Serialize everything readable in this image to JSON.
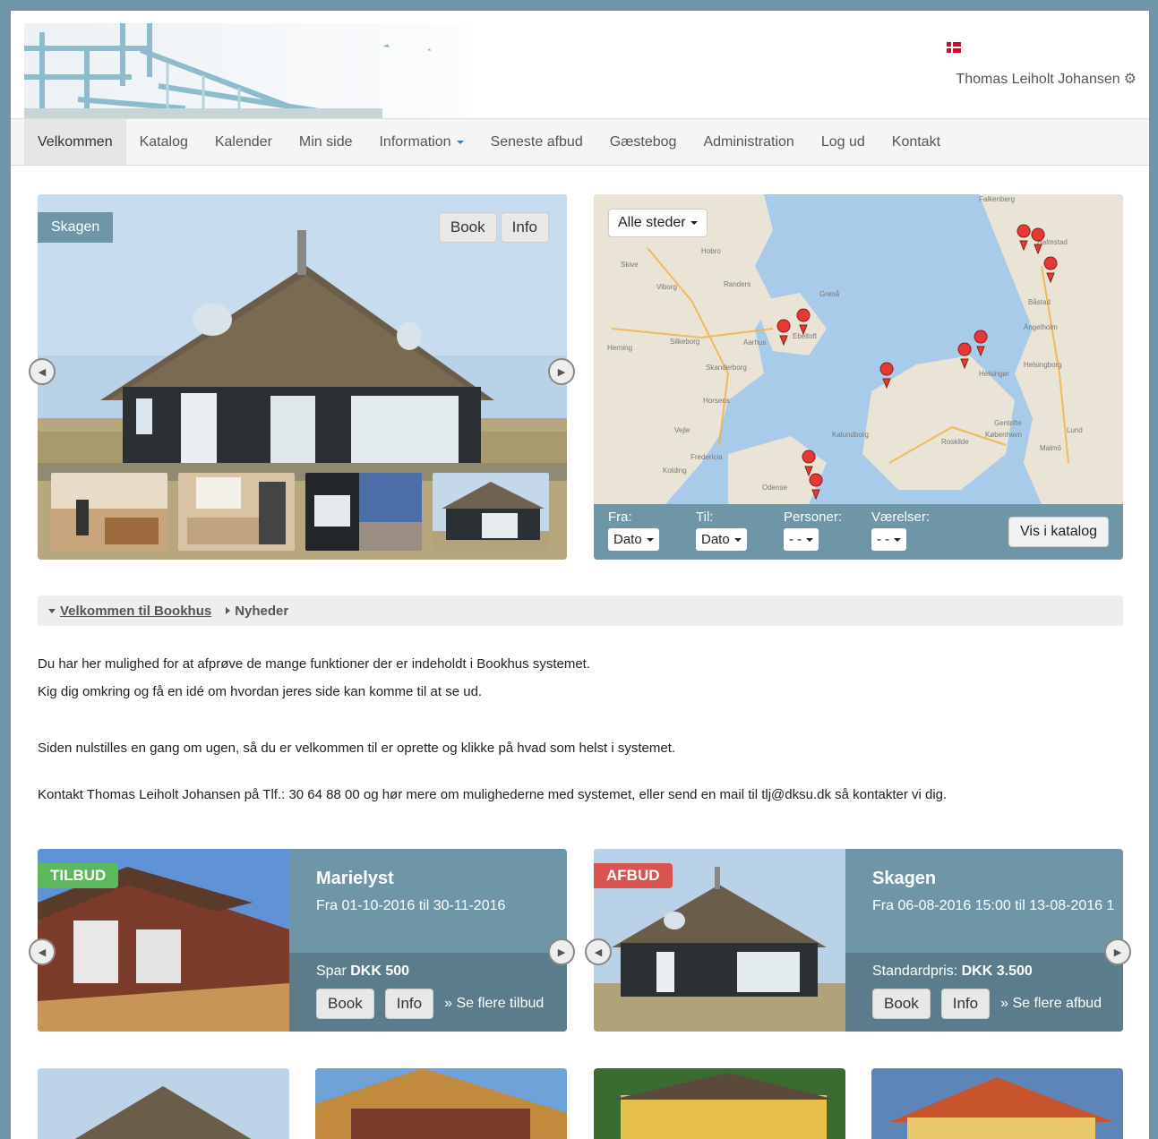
{
  "header": {
    "user_name": "Thomas Leiholt Johansen",
    "flag_icon": "danish-flag-icon",
    "settings_icon": "gear-icon"
  },
  "nav": {
    "items": [
      "Velkommen",
      "Katalog",
      "Kalender",
      "Min side",
      "Information",
      "Seneste afbud",
      "Gæstebog",
      "Administration",
      "Log ud",
      "Kontakt"
    ],
    "active": "Velkommen"
  },
  "hero": {
    "place": "Skagen",
    "book_label": "Book",
    "info_label": "Info"
  },
  "map": {
    "locations_dropdown": "Alle steder",
    "filters": {
      "from_label": "Fra:",
      "from_value": "Dato",
      "to_label": "Til:",
      "to_value": "Dato",
      "persons_label": "Personer:",
      "persons_value": "- -",
      "rooms_label": "Værelser:",
      "rooms_value": "- -"
    },
    "show_button": "Vis i katalog",
    "city_labels": [
      "Hobro",
      "Viborg",
      "Randers",
      "Skive",
      "Silkeborg",
      "Herning",
      "Aarhus",
      "Ebeltoft",
      "Skanderborg",
      "Horsens",
      "Vejle",
      "Fredericia",
      "Kolding",
      "Odense",
      "Kalundborg",
      "Roskilde",
      "København",
      "Helsingør",
      "Helsingborg",
      "Malmö",
      "Lund",
      "Gentofte",
      "Ängelholm",
      "Båstad",
      "Halmstad",
      "Falkenberg",
      "Grenå"
    ]
  },
  "breadcrumb": {
    "current": "Velkommen til Bookhus",
    "next": "Nyheder"
  },
  "content": {
    "p1": "Du har her mulighed for at afprøve de mange funktioner der er indeholdt i Bookhus systemet.",
    "p2": "Kig dig omkring og få en idé om hvordan jeres side kan komme til at se ud.",
    "p3": "Siden nulstilles en gang om ugen, så du er velkommen til er oprette og klikke på hvad som helst i systemet.",
    "p4": "Kontakt Thomas Leiholt Johansen på Tlf.: 30 64 88 00 og hør mere om mulighederne med systemet, eller send en mail til tlj@dksu.dk så kontakter vi dig."
  },
  "offers": [
    {
      "badge": "TILBUD",
      "badge_color": "#5cb85c",
      "title": "Marielyst",
      "dates": "Fra 01-10-2016 til 30-11-2016",
      "price_label": "Spar",
      "price_value": "DKK 500",
      "book_label": "Book",
      "info_label": "Info",
      "more_label": "» Se flere tilbud"
    },
    {
      "badge": "AFBUD",
      "badge_color": "#d9534f",
      "title": "Skagen",
      "dates": "Fra 06-08-2016 15:00 til 13-08-2016 1",
      "price_label": "Standardpris:",
      "price_value": "DKK 3.500",
      "book_label": "Book",
      "info_label": "Info",
      "more_label": "» Se flere afbud"
    }
  ],
  "colors": {
    "brand": "#6f96a6",
    "brand_dark": "#5b7d8b",
    "offer_badge": "#5cb85c",
    "cancel_badge": "#d9534f",
    "map_pin": "#e53935"
  }
}
